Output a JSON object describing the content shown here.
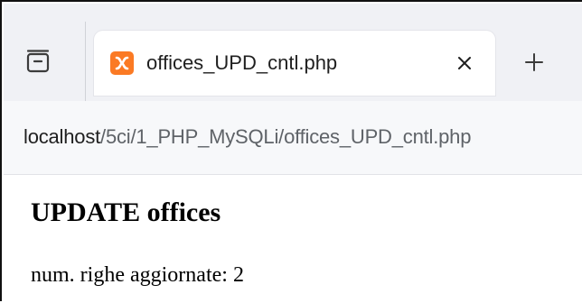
{
  "browser": {
    "tab": {
      "title": "offices_UPD_cntl.php",
      "favicon": "xampp-icon",
      "favicon_color": "#fb7a24"
    },
    "tab_overview_icon": "tab-overview-icon",
    "close_icon": "close-icon",
    "new_tab_icon": "plus-icon",
    "address": {
      "host": "localhost",
      "path": "/5ci/1_PHP_MySQLi/offices_UPD_cntl.php"
    }
  },
  "page": {
    "heading": "UPDATE offices",
    "result_label": "num. righe aggiornate:",
    "result_value": "2"
  }
}
